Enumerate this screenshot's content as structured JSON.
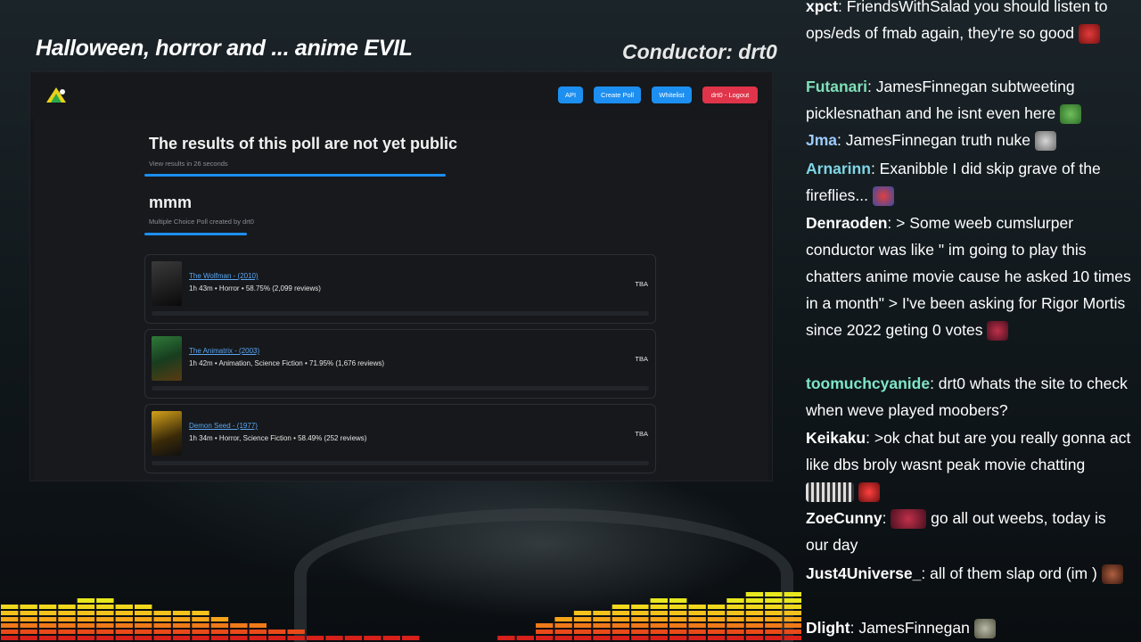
{
  "stream": {
    "title": "Halloween, horror and ... anime EVIL",
    "conductor": "Conductor: drt0"
  },
  "app": {
    "nav": {
      "api": "API",
      "create_poll": "Create Poll",
      "whitelist": "Whitelist",
      "logout": "drt0 - Logout"
    },
    "notice": {
      "title": "The results of this poll are not yet public",
      "subtitle": "View results in 26 seconds"
    },
    "poll": {
      "title": "mmm",
      "subtitle": "Multiple Choice Poll created by drt0"
    },
    "movies": [
      {
        "title": "The Wolfman - (2010)",
        "meta": "1h 43m • Horror • 58.75% (2,099 reviews)",
        "status": "TBA"
      },
      {
        "title": "The Animatrix - (2003)",
        "meta": "1h 42m • Animation, Science Fiction • 71.95% (1,676 reviews)",
        "status": "TBA"
      },
      {
        "title": "Demon Seed - (1977)",
        "meta": "1h 34m • Horror, Science Fiction • 58.49% (252 reviews)",
        "status": "TBA"
      }
    ]
  },
  "chat": [
    {
      "user": "xpct",
      "color": "#ffffff",
      "text": "FriendsWithSalad you should listen to ops/eds of fmab again, they're so good",
      "emote": "devil-emote"
    },
    {
      "user": "Futanari",
      "color": "#7fe0b8",
      "text": "JamesFinnegan subtweeting picklesnathan and he isnt even here",
      "emote": "frog-emote"
    },
    {
      "user": "Jma",
      "color": "#9ecbff",
      "text": "JamesFinnegan truth nuke",
      "emote": "skull-emote"
    },
    {
      "user": "Arnarinn",
      "color": "#7fd6e6",
      "text": "Exanibble I did skip grave of the fireflies...",
      "emote": "sad-emote"
    },
    {
      "user": "Denraoden",
      "color": "#ffffff",
      "text": "> Some weeb cumslurper conductor was like \" im going to play this chatters anime movie cause he asked 10 times in a month\" > I've been asking for Rigor Mortis since 2022 geting 0 votes",
      "emote": "dance-emote"
    },
    {
      "user": "toomuchcyanide",
      "color": "#7fe6c8",
      "text": "drt0 whats the site to check when weve played moobers?",
      "emote": ""
    },
    {
      "user": "Keikaku",
      "color": "#ffffff",
      "text": ">ok chat but are you really gonna act like dbs broly wasnt peak movie chatting",
      "emote": "hype-emote"
    },
    {
      "user": "ZoeCunny",
      "color": "#ffffff",
      "text": "go all out weebs, today is our day",
      "emote": "dance-emote"
    },
    {
      "user": "Just4Universe_",
      "color": "#ffffff",
      "text": "all of them slap ord (im )",
      "emote": "hands-emote"
    },
    {
      "user": "Dlight",
      "color": "#ffffff",
      "text": "JamesFinnegan",
      "emote": "face-emote"
    }
  ]
}
